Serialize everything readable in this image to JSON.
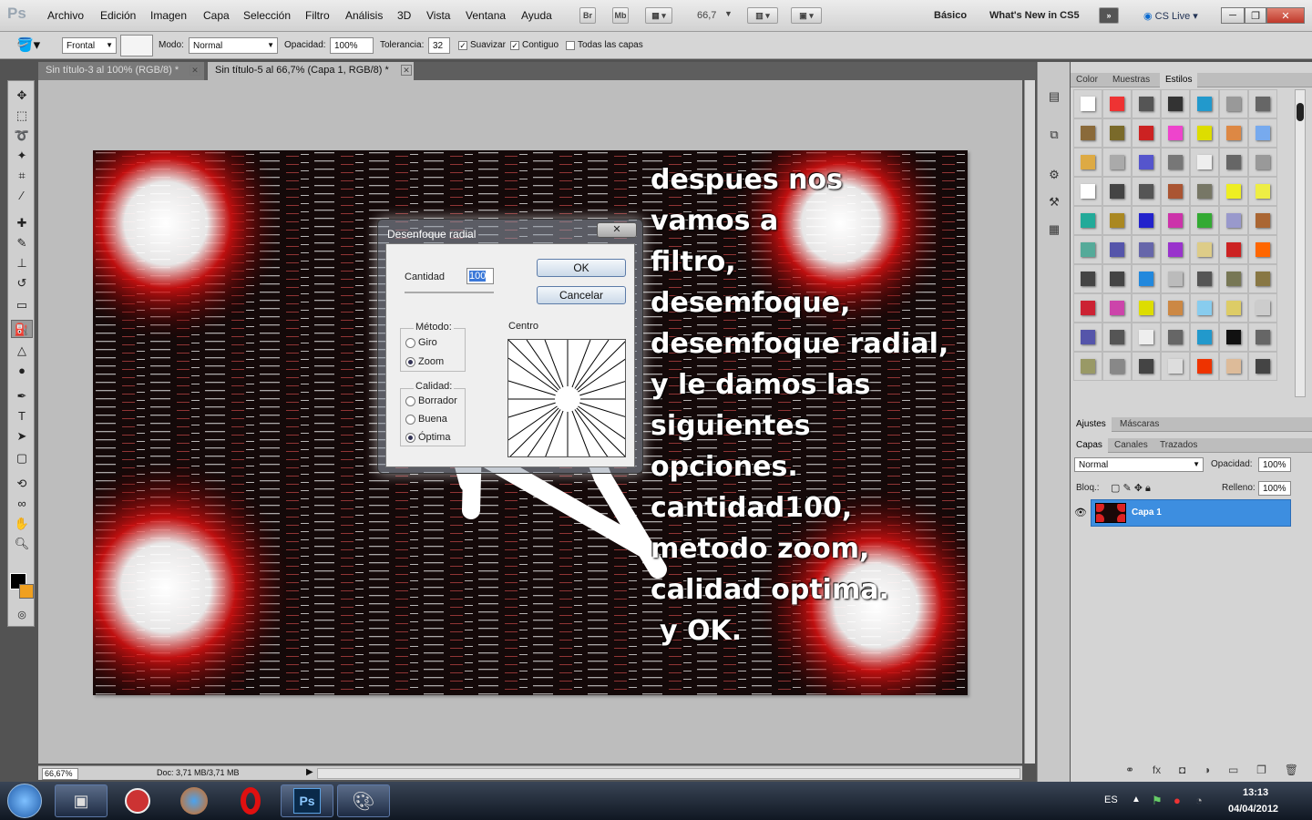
{
  "app": {
    "logo": "Ps"
  },
  "menu": [
    "Archivo",
    "Edición",
    "Imagen",
    "Capa",
    "Selección",
    "Filtro",
    "Análisis",
    "3D",
    "Vista",
    "Ventana",
    "Ayuda"
  ],
  "toolbar": {
    "br": "Br",
    "mb": "Mb",
    "zoom": "66,7",
    "workspace_basic": "Básico",
    "whats_new": "What's New in CS5",
    "cs_live": "CS Live"
  },
  "options": {
    "preset": "Frontal",
    "mode_label": "Modo:",
    "mode_value": "Normal",
    "opacity_label": "Opacidad:",
    "opacity_value": "100%",
    "tolerance_label": "Tolerancia:",
    "tolerance_value": "32",
    "antialias_label": "Suavizar",
    "contiguous_label": "Contiguo",
    "all_layers_label": "Todas las capas"
  },
  "tabs": [
    {
      "label": "Sin título-3 al 100% (RGB/8) *"
    },
    {
      "label": "Sin título-5 al 66,7% (Capa 1, RGB/8) *"
    }
  ],
  "overlay_text": [
    "despues nos",
    "vamos a",
    "filtro,",
    "desemfoque,",
    "desemfoque radial,",
    "y le damos las",
    "siguientes opciones.",
    "cantidad100,",
    "metodo zoom,",
    "calidad optima.",
    "y OK."
  ],
  "dialog": {
    "title": "Desenfoque radial",
    "close": "✕",
    "amount_label": "Cantidad",
    "amount_value": "100",
    "ok": "OK",
    "cancel": "Cancelar",
    "method_label": "Método:",
    "method_spin": "Giro",
    "method_zoom": "Zoom",
    "quality_label": "Calidad:",
    "quality_draft": "Borrador",
    "quality_good": "Buena",
    "quality_best": "Óptima",
    "center_label": "Centro"
  },
  "panels": {
    "top_tabs": [
      "Color",
      "Muestras",
      "Estilos"
    ],
    "mid_tabs": [
      "Ajustes",
      "Máscaras"
    ],
    "layer_tabs": [
      "Capas",
      "Canales",
      "Trazados"
    ],
    "blend_mode": "Normal",
    "opacity_label": "Opacidad:",
    "opacity_value": "100%",
    "lock_label": "Bloq.:",
    "fill_label": "Relleno:",
    "fill_value": "100%",
    "layer_name": "Capa 1"
  },
  "style_colors": [
    "#fff",
    "#e33",
    "#555",
    "#333",
    "#29c",
    "#999",
    "#666",
    "#8a6a3a",
    "#7a6a2a",
    "#c22",
    "#e4c",
    "#dd0",
    "#d84",
    "#7ae",
    "#da4",
    "#aaa",
    "#55c",
    "#777",
    "#eee",
    "#666",
    "#999",
    "#fff",
    "#444",
    "#555",
    "#a53",
    "#776",
    "#ee2",
    "#ee4",
    "#2a9",
    "#a82",
    "#22c",
    "#c3a",
    "#3a3",
    "#99c",
    "#a63",
    "#5a9",
    "#55a",
    "#66a",
    "#93c",
    "#dc8",
    "#c22",
    "#f60",
    "#444",
    "#444",
    "#28d",
    "#bbb",
    "#555",
    "#775",
    "#874",
    "#c23",
    "#c4a",
    "#dd0",
    "#c84",
    "#8ce",
    "#dc6",
    "#ccc",
    "#55a",
    "#555",
    "#eee",
    "#666",
    "#29c",
    "#111",
    "#666",
    "#996",
    "#888",
    "#444",
    "#ddd",
    "#e30",
    "#db9",
    "#444"
  ],
  "status": {
    "zoom": "66,67%",
    "doc": "Doc: 3,71 MB/3,71 MB"
  },
  "taskbar": {
    "lang": "ES",
    "time": "13:13",
    "date": "04/04/2012",
    "ps": "Ps"
  }
}
